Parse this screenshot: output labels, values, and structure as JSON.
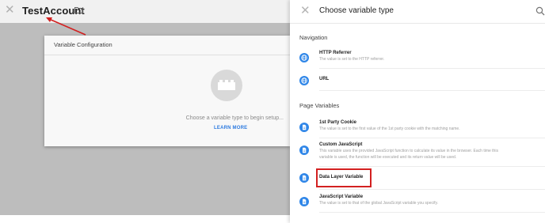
{
  "left": {
    "title": "TestAccount",
    "close_icon": "close-icon",
    "folder_icon": "folder-icon",
    "config_card": {
      "title": "Variable Configuration",
      "hint": "Choose a variable type to begin setup...",
      "learn_more": "LEARN MORE",
      "placeholder_icon": "lego-brick-icon"
    }
  },
  "panel": {
    "title": "Choose variable type",
    "close_icon": "close-icon",
    "search_icon": "search-icon",
    "sections": [
      {
        "label": "Navigation",
        "items": [
          {
            "title": "HTTP Referrer",
            "desc": "The value is set to the HTTP referrer.",
            "icon": "globe-icon"
          },
          {
            "title": "URL",
            "desc": "",
            "icon": "globe-icon"
          }
        ]
      },
      {
        "label": "Page Variables",
        "items": [
          {
            "title": "1st Party Cookie",
            "desc": "The value is set to the first value of the 1st party cookie with the matching name.",
            "icon": "document-icon"
          },
          {
            "title": "Custom JavaScript",
            "desc": "This variable uses the provided JavaScript function to calculate its value in the browser. Each time this",
            "desc2": "variable is used, the function will be executed and its return value will be used.",
            "icon": "document-icon"
          },
          {
            "title": "Data Layer Variable",
            "desc": "",
            "icon": "document-icon"
          },
          {
            "title": "JavaScript Variable",
            "desc": "The value is set to that of the global JavaScript variable you specify.",
            "icon": "document-icon"
          }
        ]
      }
    ]
  },
  "annotation_color": "#d32020",
  "accent_color": "#2f86e8"
}
